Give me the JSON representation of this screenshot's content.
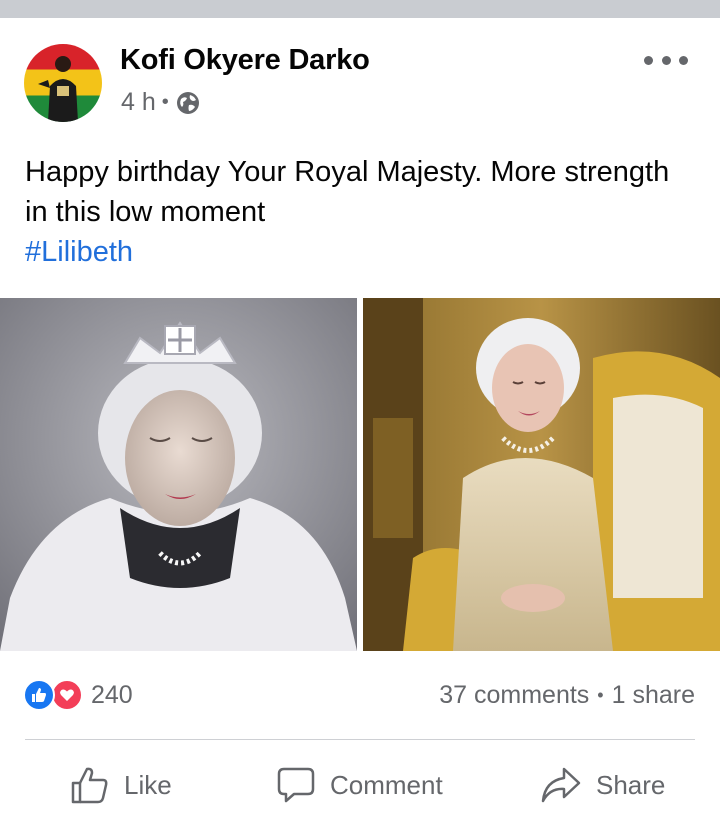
{
  "post": {
    "author": "Kofi Okyere Darko",
    "time": "4 h",
    "privacy_icon": "globe-icon",
    "text": "Happy birthday Your Royal Majesty. More strength in this low moment",
    "hashtag": "#Lilibeth",
    "photos": [
      {
        "icon": "photo-crowned-portrait"
      },
      {
        "icon": "photo-seated-portrait"
      }
    ]
  },
  "stats": {
    "reaction_icons": [
      "like-reaction-icon",
      "love-reaction-icon"
    ],
    "reaction_count": "240",
    "comments": "37 comments",
    "shares": "1 share"
  },
  "actions": {
    "like": "Like",
    "comment": "Comment",
    "share": "Share"
  },
  "colors": {
    "link": "#216fdb",
    "like_blue": "#1877f2",
    "love_red": "#f33e58",
    "secondary_text": "#65676b"
  }
}
